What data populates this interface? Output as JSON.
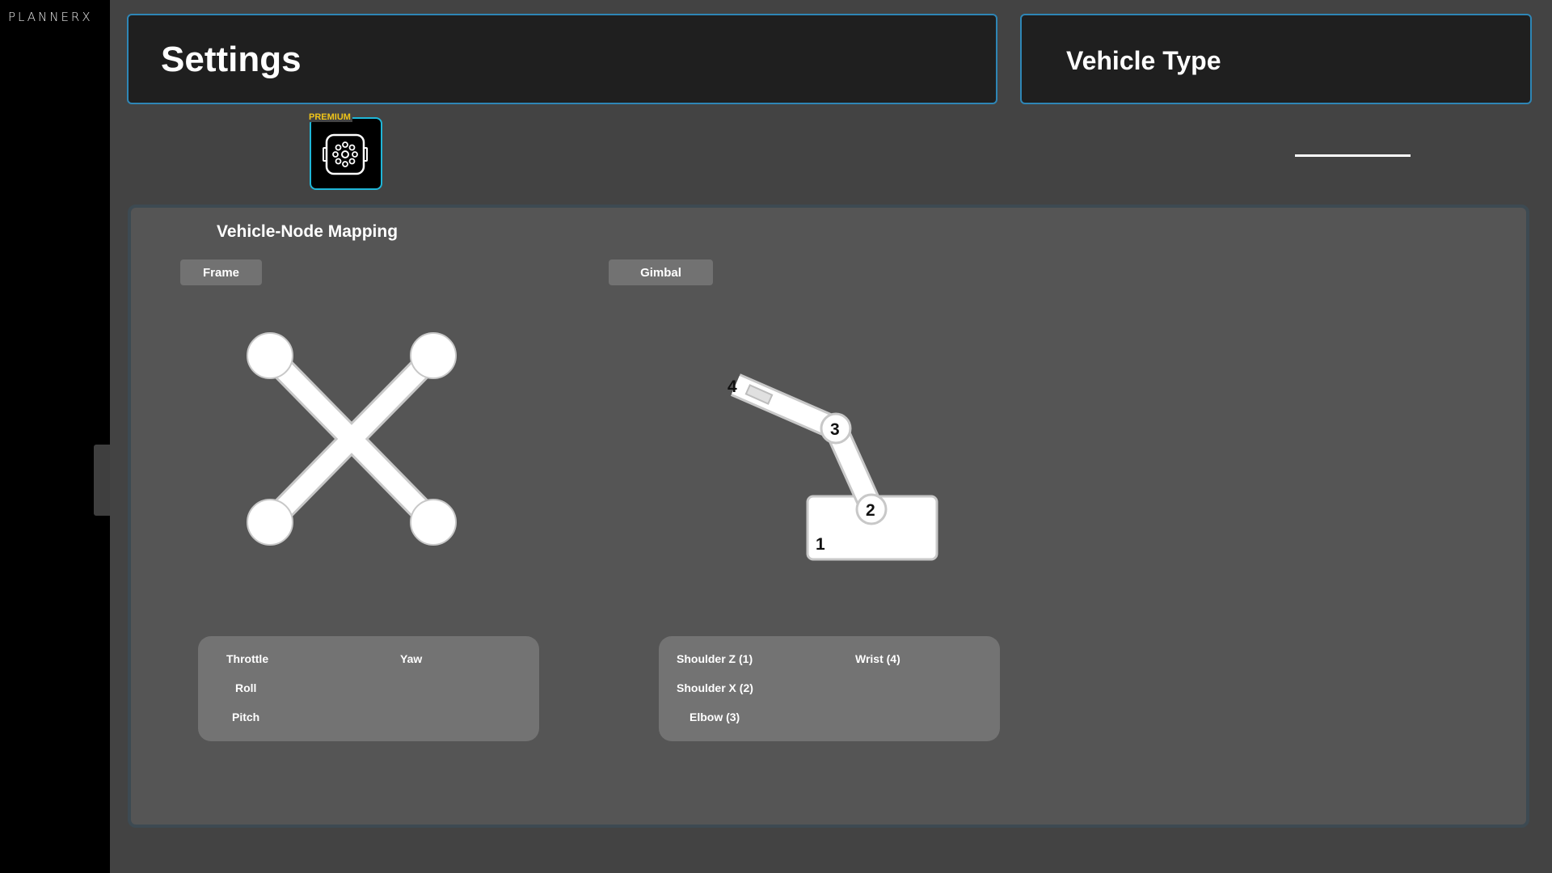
{
  "app": {
    "logo": "PLANNERX"
  },
  "header": {
    "settings_title": "Settings",
    "vehicle_type_title": "Vehicle Type"
  },
  "premium": {
    "label": "PREMIUM",
    "icon": "robot-node-icon"
  },
  "mapping": {
    "title": "Vehicle-Node Mapping",
    "frame_tab": "Frame",
    "gimbal_tab": "Gimbal",
    "frame_items": [
      "Throttle",
      "Roll",
      "Pitch",
      "Yaw"
    ],
    "gimbal_items": [
      "Shoulder Z (1)",
      "Shoulder X (2)",
      "Elbow (3)",
      "Wrist (4)"
    ],
    "gimbal_nodes": [
      "1",
      "2",
      "3",
      "4"
    ]
  },
  "colors": {
    "accent_border": "#2e86b6",
    "premium_border": "#1fb6d8",
    "premium_label": "#f0c419"
  }
}
